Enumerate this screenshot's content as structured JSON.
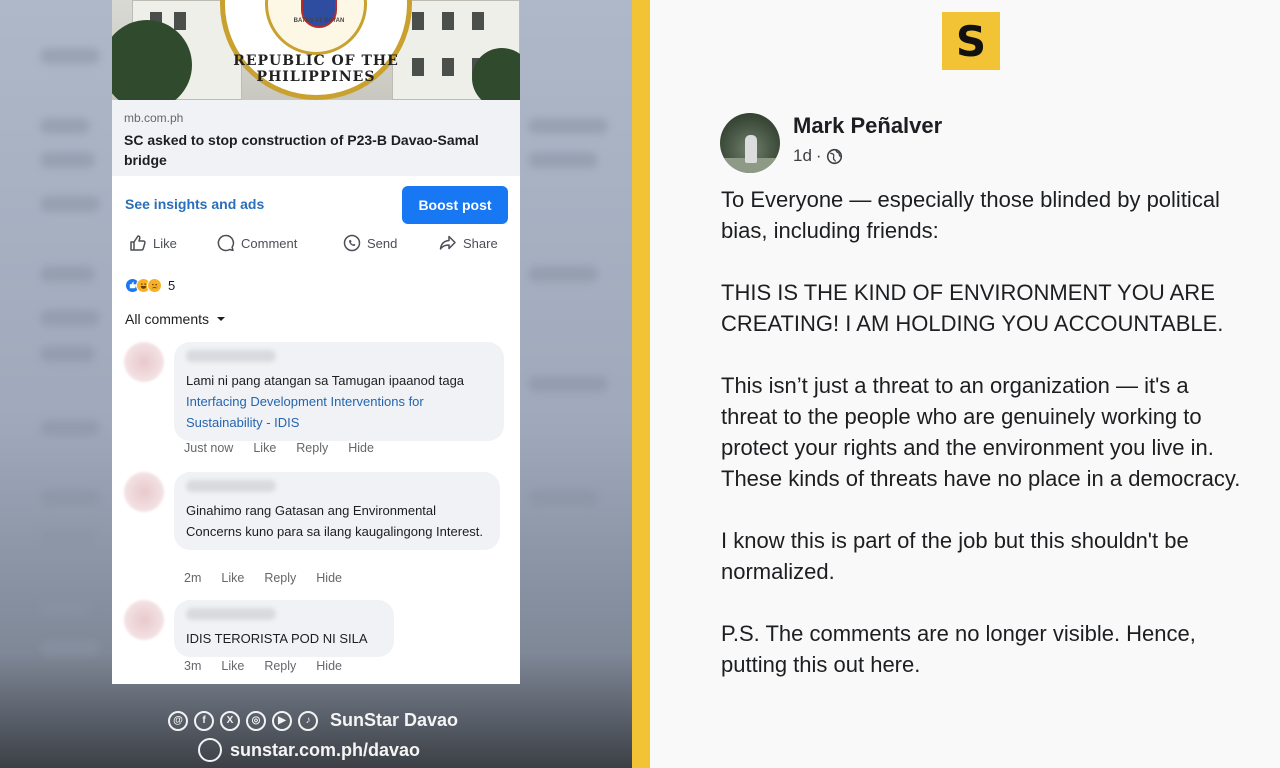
{
  "link_preview": {
    "domain": "mb.com.ph",
    "headline": "SC asked to stop construction of P23-B Davao-Samal bridge",
    "seal_text": "REPUBLIC OF THE PHILIPPINES",
    "seal_motto": "BATAS AT BAYAN"
  },
  "post_toolbar": {
    "insights_label": "See insights and ads",
    "boost_label": "Boost post"
  },
  "actions": {
    "like": "Like",
    "comment": "Comment",
    "send": "Send",
    "share": "Share"
  },
  "reactions": {
    "count": "5",
    "types": [
      "like-icon",
      "haha-icon",
      "sad-icon"
    ]
  },
  "comments_filter": "All comments",
  "comments": [
    {
      "text": "Lami ni pang atangan sa Tamugan ipaanod taga ",
      "tag": "Interfacing Development Interventions for Sustainability - IDIS",
      "time": "Just now",
      "like": "Like",
      "reply": "Reply",
      "hide": "Hide"
    },
    {
      "text": "Ginahimo rang Gatasan ang Environmental Concerns kuno para sa ilang kaugalingong Interest.",
      "time": "2m",
      "like": "Like",
      "reply": "Reply",
      "hide": "Hide"
    },
    {
      "text": "IDIS TERORISTA POD NI SILA",
      "time": "3m",
      "like": "Like",
      "reply": "Reply",
      "hide": "Hide"
    }
  ],
  "branding": {
    "social_icons": [
      "threads-icon",
      "facebook-icon",
      "x-icon",
      "instagram-icon",
      "youtube-icon",
      "tiktok-icon"
    ],
    "name": "SunStar Davao",
    "url": "sunstar.com.ph/davao",
    "logo_letter": "S",
    "accent_color": "#f2c335"
  },
  "post": {
    "author": "Mark Peñalver",
    "time": "1d",
    "privacy_icon": "globe-icon",
    "paragraphs": [
      "To Everyone — especially those blinded by political bias, including friends:",
      "THIS IS THE KIND OF ENVIRONMENT YOU ARE CREATING! I AM HOLDING YOU ACCOUNTABLE.",
      "This isn’t just a threat to an organization — it's a threat to the people who are genuinely working to protect your rights and the environment you live in. These kinds of threats have no place in a democracy.",
      "I know this is part of the job but this shouldn't be normalized.",
      "P.S. The comments are no longer visible. Hence, putting this out here."
    ]
  }
}
